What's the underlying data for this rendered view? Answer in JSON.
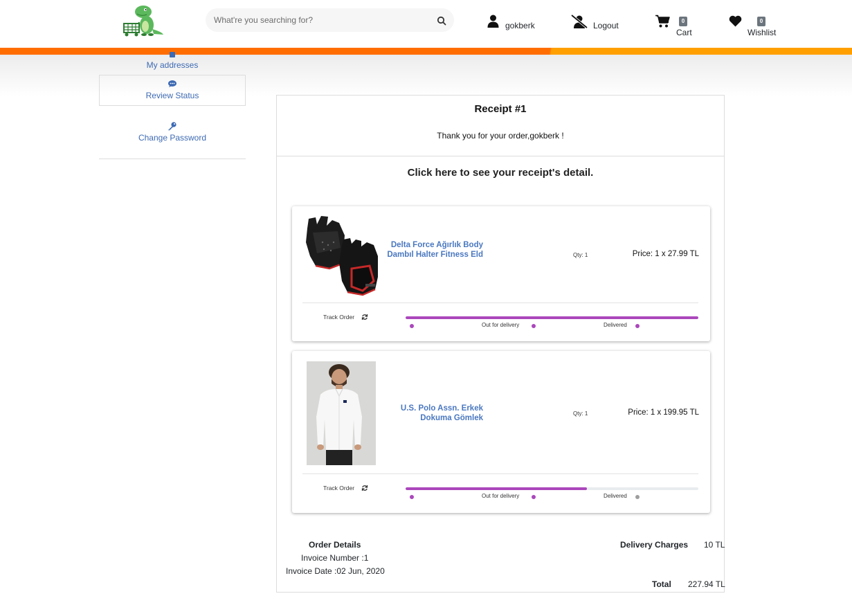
{
  "header": {
    "search_placeholder": "What're you searching for?",
    "username": "gokberk",
    "logout_label": "Logout",
    "cart_label": "Cart",
    "cart_count": "0",
    "wishlist_label": "Wishlist",
    "wishlist_count": "0"
  },
  "sidebar": {
    "items": [
      {
        "label": "My addresses",
        "icon": "address-card-icon"
      },
      {
        "label": "Review Status",
        "icon": "comment-icon"
      },
      {
        "label": "Change Password",
        "icon": "key-icon"
      }
    ]
  },
  "receipt": {
    "title": "Receipt #1",
    "thanks": "Thank you for your order,gokberk !",
    "detail_link": "Click here to see your receipt's detail.",
    "items": [
      {
        "name": "Delta Force Ağırlık Body Dambıl Halter Fitness Eld",
        "qty": "Qty: 1",
        "price": "Price: 1 x 27.99 TL",
        "image": "fitness-gloves-image",
        "track_label": "Track Order",
        "steps": [
          "Out for delivery",
          "Delivered"
        ],
        "progress": 1.0
      },
      {
        "name": "U.S. Polo Assn. Erkek Dokuma Gömlek",
        "qty": "Qty: 1",
        "price": "Price: 1 x 199.95 TL",
        "image": "white-shirt-model-image",
        "track_label": "Track Order",
        "steps": [
          "Out for delivery",
          "Delivered"
        ],
        "progress": 0.62
      }
    ],
    "order_details": {
      "heading": "Order Details",
      "invoice_number": "Invoice Number :1",
      "invoice_date": "Invoice Date :02 Jun, 2020"
    },
    "delivery_label": "Delivery Charges",
    "delivery_value": "10 TL",
    "total_label": "Total",
    "total_value": "227.94 TL"
  },
  "colors": {
    "accent_orange": "#ff6d00",
    "accent_amber": "#ffa000",
    "link_blue": "#3d6ab3",
    "progress_purple": "#ab47bc",
    "inactive_dot": "#9e9e9e"
  }
}
